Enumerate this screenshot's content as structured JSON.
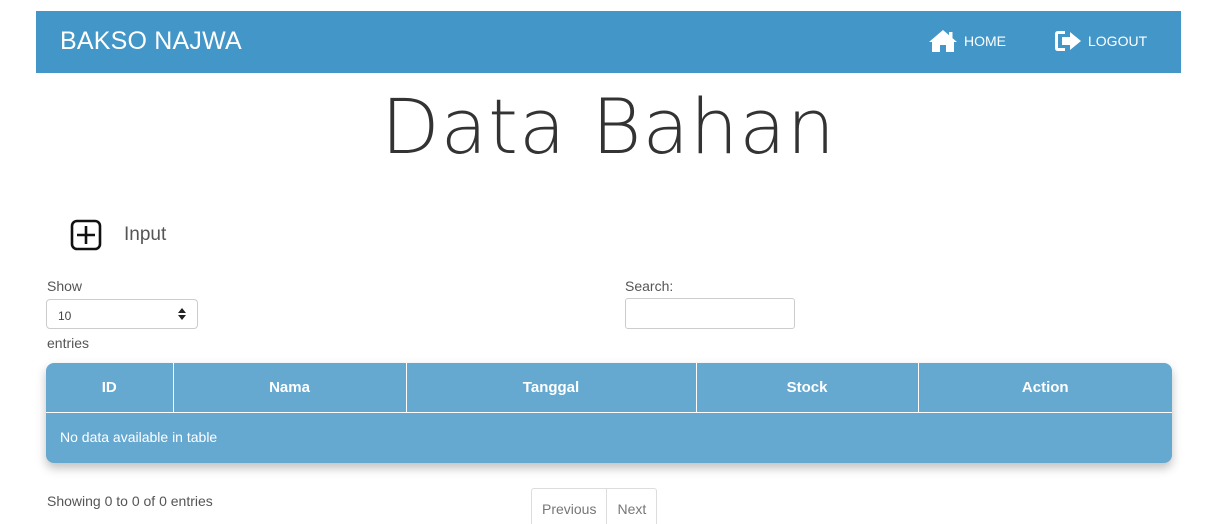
{
  "navbar": {
    "brand": "BAKSO NAJWA",
    "home_label": "HOME",
    "logout_label": "LOGOUT",
    "bg_color": "#4296c8"
  },
  "page": {
    "title": "Data Bahan"
  },
  "toolbar": {
    "input_label": "Input",
    "input_icon": "plus-square-icon"
  },
  "length_control": {
    "show_label": "Show",
    "selected_value": "10",
    "entries_label": "entries"
  },
  "search": {
    "label": "Search:",
    "value": "",
    "placeholder": ""
  },
  "table": {
    "columns": [
      "ID",
      "Nama",
      "Tanggal",
      "Stock",
      "Action"
    ],
    "empty_message": "No data available in table",
    "color": "#65a8d0"
  },
  "footer": {
    "info": "Showing 0 to 0 of 0 entries",
    "previous_label": "Previous",
    "next_label": "Next"
  }
}
